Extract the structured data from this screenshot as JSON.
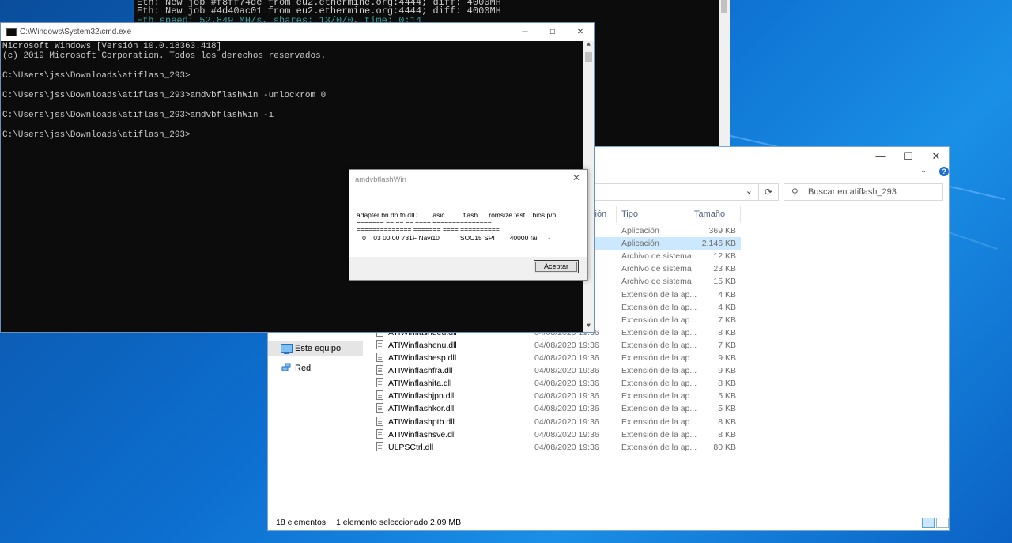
{
  "miner": {
    "lines": [
      "Eth: New job #f8ff74de from eu2.ethermine.org:4444; diff: 4000MH",
      "Eth: New job #4d40ac01 from eu2.ethermine.org:4444; diff: 4000MH",
      "Eth speed: 52.849 MH/s, shares: 13/0/0, time: 0:14"
    ]
  },
  "cmd": {
    "title": "C:\\Windows\\System32\\cmd.exe",
    "lines": [
      "Microsoft Windows [Versión 10.0.18363.418]",
      "(c) 2019 Microsoft Corporation. Todos los derechos reservados.",
      "",
      "C:\\Users\\jss\\Downloads\\atiflash_293>",
      "",
      "C:\\Users\\jss\\Downloads\\atiflash_293>amdvbflashWin -unlockrom 0",
      "",
      "C:\\Users\\jss\\Downloads\\atiflash_293>amdvbflashWin -i",
      "",
      "C:\\Users\\jss\\Downloads\\atiflash_293>"
    ],
    "controls": {
      "minimize": "—",
      "maximize": "☐",
      "close": "✕"
    }
  },
  "dialog": {
    "title": "amdvbflashWin",
    "header": "adapter bn dn fn dID        asic          flash      romsize test    bios p/n",
    "sep1": "======= == == == ==== =============== ",
    "sep2": "============== ======= ==== ==========",
    "row": "   0    03 00 00 731F Navi10           SOC15 SPI        40000 fail     -",
    "ok_label": "Aceptar"
  },
  "explorer": {
    "controls": {
      "minimize": "—",
      "maximize": "☐",
      "close": "✕"
    },
    "search_placeholder": "Buscar en atiflash_293",
    "columns": {
      "date_partial": "ción",
      "type": "Tipo",
      "size": "Tamaño"
    },
    "nav": [
      {
        "label": "Este equipo",
        "icon": "computer-icon",
        "selected": true
      },
      {
        "label": "Red",
        "icon": "network-icon",
        "selected": false
      }
    ],
    "rows": [
      {
        "name": "",
        "date": "",
        "type": "Aplicación",
        "size": "369 KB",
        "selected": false
      },
      {
        "name": "",
        "date": "",
        "type": "Aplicación",
        "size": "2.146 KB",
        "selected": true
      },
      {
        "name": "",
        "date": "",
        "type": "Archivo de sistema",
        "size": "12 KB",
        "selected": false
      },
      {
        "name": "",
        "date": "",
        "type": "Archivo de sistema",
        "size": "23 KB",
        "selected": false
      },
      {
        "name": "",
        "date": "",
        "type": "Archivo de sistema",
        "size": "15 KB",
        "selected": false
      },
      {
        "name": "",
        "date": "",
        "type": "Extensión de la ap...",
        "size": "4 KB",
        "selected": false
      },
      {
        "name": "",
        "date": "",
        "type": "Extensión de la ap...",
        "size": "4 KB",
        "selected": false
      },
      {
        "name": "",
        "date": "",
        "type": "Extensión de la ap...",
        "size": "7 KB",
        "selected": false
      },
      {
        "name": "ATIWinflashdeu.dll",
        "date": "04/08/2020 19:36",
        "type": "Extensión de la ap...",
        "size": "8 KB",
        "selected": false
      },
      {
        "name": "ATIWinflashenu.dll",
        "date": "04/08/2020 19:36",
        "type": "Extensión de la ap...",
        "size": "7 KB",
        "selected": false
      },
      {
        "name": "ATIWinflashesp.dll",
        "date": "04/08/2020 19:36",
        "type": "Extensión de la ap...",
        "size": "9 KB",
        "selected": false
      },
      {
        "name": "ATIWinflashfra.dll",
        "date": "04/08/2020 19:36",
        "type": "Extensión de la ap...",
        "size": "9 KB",
        "selected": false
      },
      {
        "name": "ATIWinflashita.dll",
        "date": "04/08/2020 19:36",
        "type": "Extensión de la ap...",
        "size": "8 KB",
        "selected": false
      },
      {
        "name": "ATIWinflashjpn.dll",
        "date": "04/08/2020 19:36",
        "type": "Extensión de la ap...",
        "size": "5 KB",
        "selected": false
      },
      {
        "name": "ATIWinflashkor.dll",
        "date": "04/08/2020 19:36",
        "type": "Extensión de la ap...",
        "size": "5 KB",
        "selected": false
      },
      {
        "name": "ATIWinflashptb.dll",
        "date": "04/08/2020 19:36",
        "type": "Extensión de la ap...",
        "size": "8 KB",
        "selected": false
      },
      {
        "name": "ATIWinflashsve.dll",
        "date": "04/08/2020 19:36",
        "type": "Extensión de la ap...",
        "size": "8 KB",
        "selected": false
      },
      {
        "name": "ULPSCtrl.dll",
        "date": "04/08/2020 19:36",
        "type": "Extensión de la ap...",
        "size": "80 KB",
        "selected": false
      }
    ],
    "status": {
      "count": "18 elementos",
      "selection": "1 elemento seleccionado  2,09 MB"
    },
    "colors": {
      "selection": "#cce8ff",
      "accent": "#0078d7"
    }
  }
}
